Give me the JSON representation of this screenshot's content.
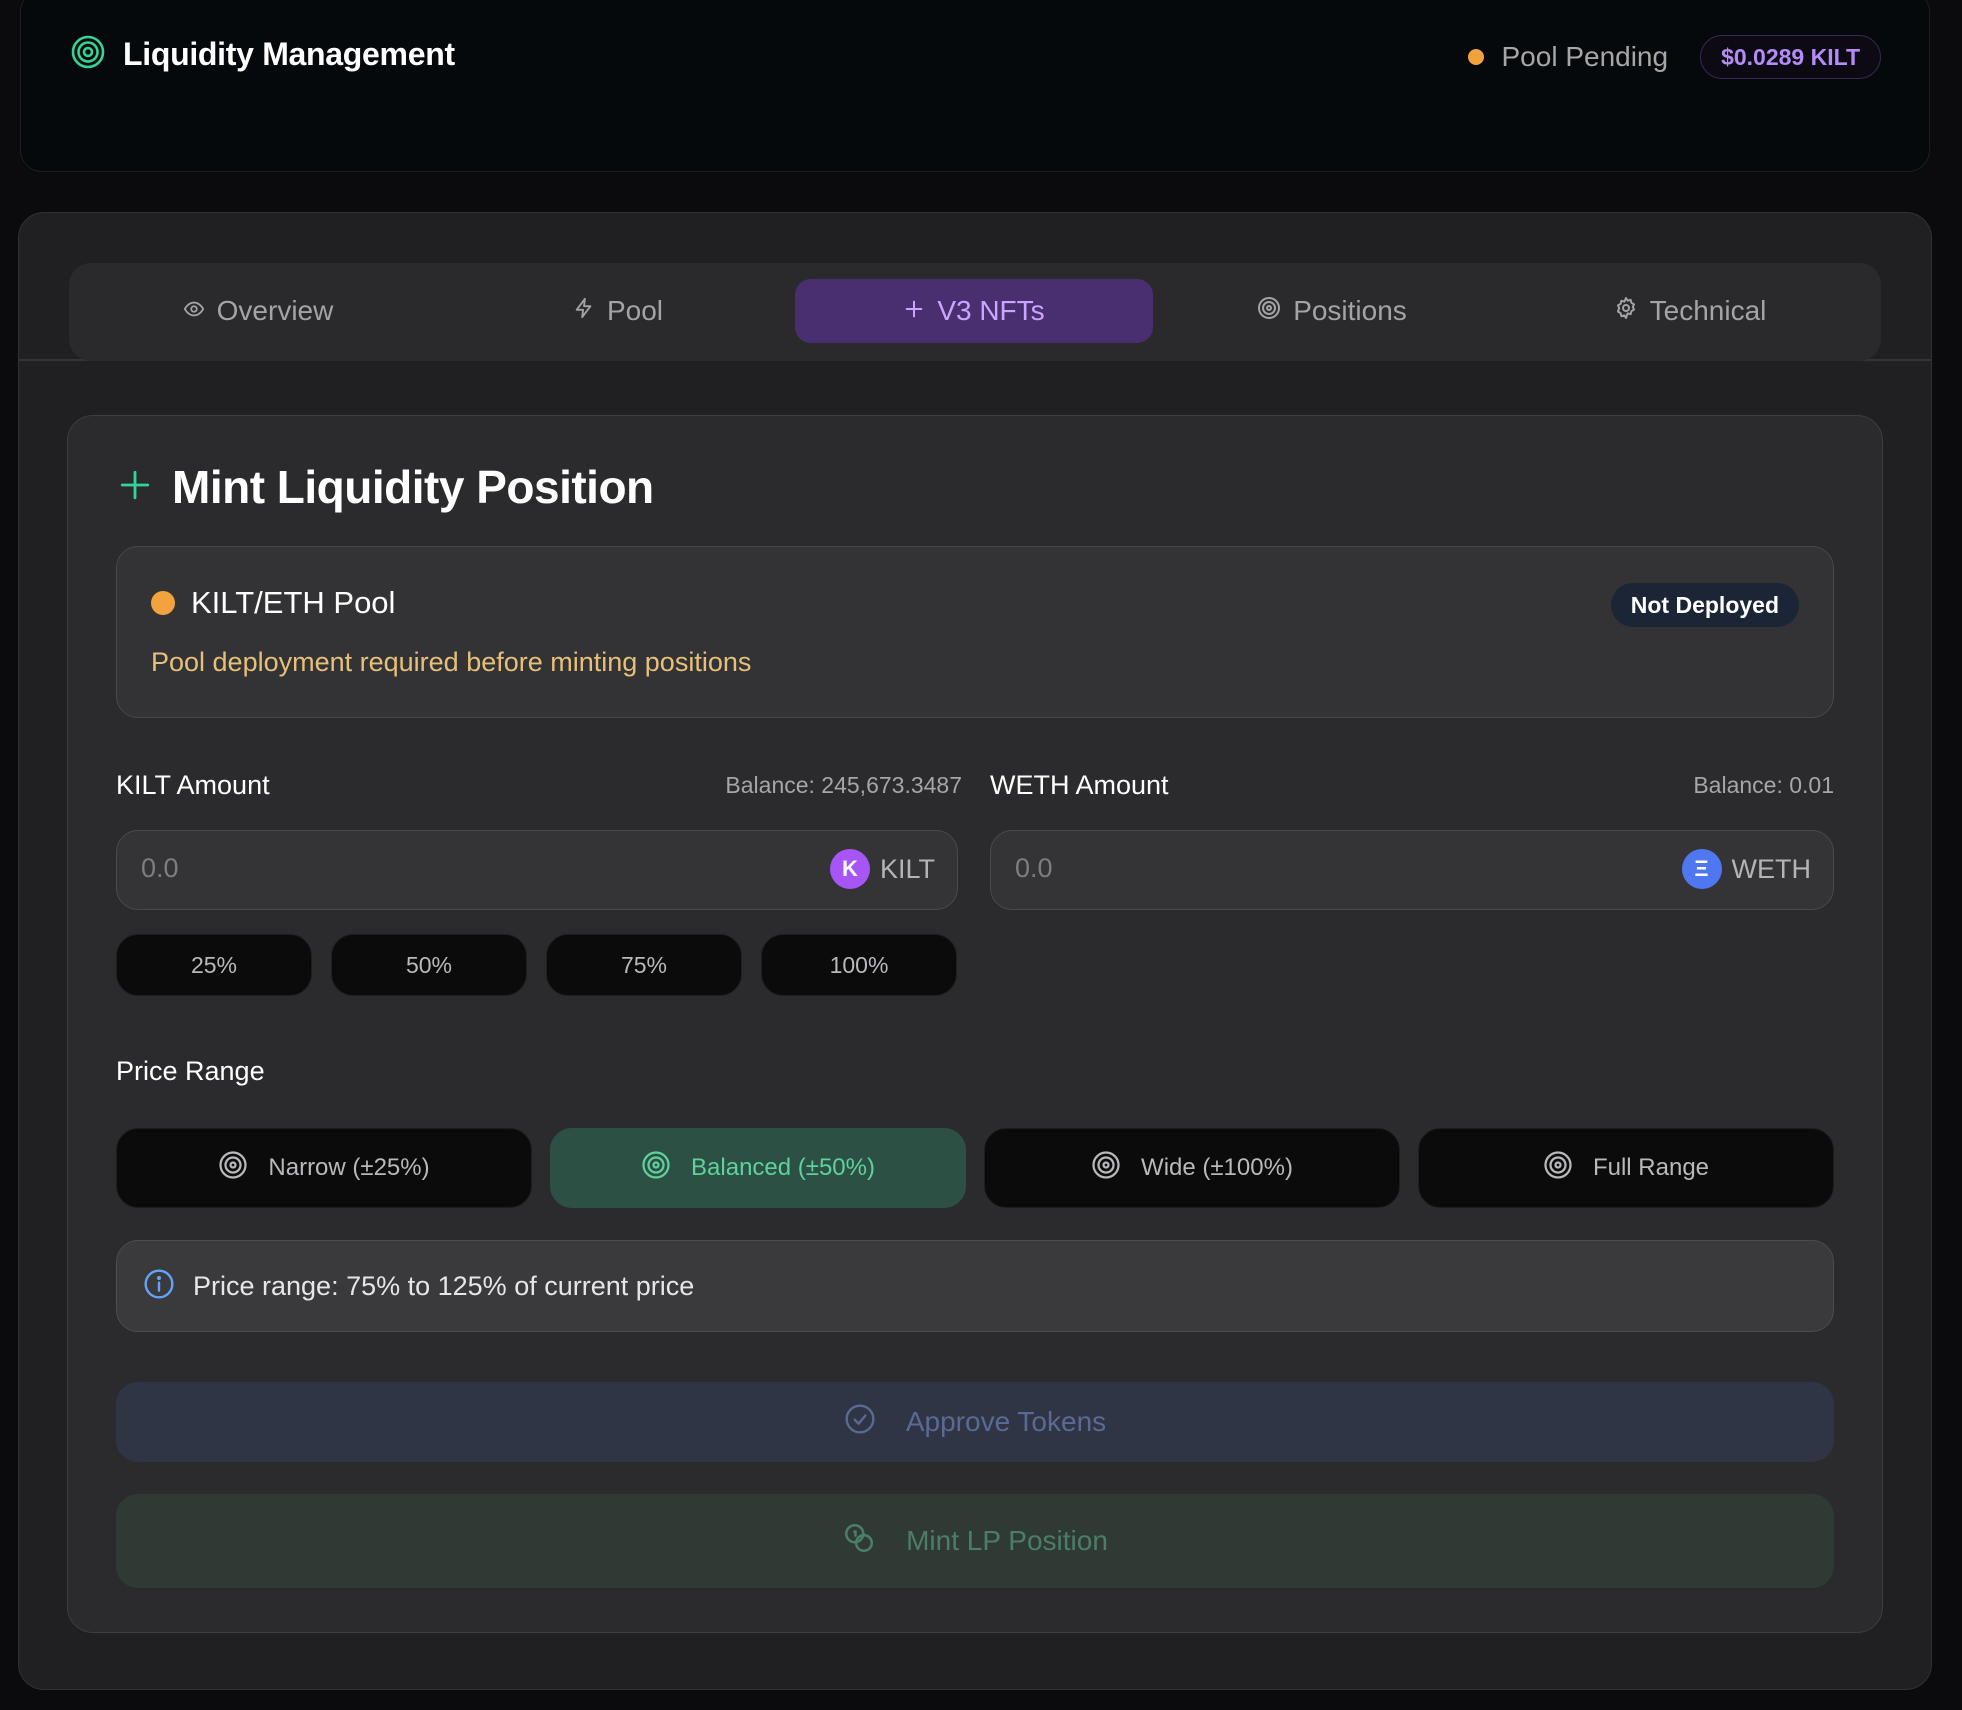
{
  "header": {
    "title": "Liquidity Management",
    "status_text": "Pool Pending",
    "price_badge": "$0.0289 KILT"
  },
  "tabs": [
    {
      "label": "Overview",
      "icon": "eye-icon"
    },
    {
      "label": "Pool",
      "icon": "lightning-icon"
    },
    {
      "label": "V3 NFTs",
      "icon": "plus-icon"
    },
    {
      "label": "Positions",
      "icon": "target-icon"
    },
    {
      "label": "Technical",
      "icon": "gear-icon"
    }
  ],
  "card": {
    "title": "Mint Liquidity Position",
    "pool": {
      "name": "KILT/ETH Pool",
      "message": "Pool deployment required before minting positions",
      "badge": "Not Deployed"
    },
    "kilt": {
      "label": "KILT Amount",
      "balance": "Balance: 245,673.3487",
      "placeholder": "0.0",
      "token_letter": "K",
      "token": "KILT"
    },
    "weth": {
      "label": "WETH Amount",
      "balance": "Balance: 0.01",
      "placeholder": "0.0",
      "token_letter": "Ξ",
      "token": "WETH"
    },
    "percent_buttons": [
      "25%",
      "50%",
      "75%",
      "100%"
    ],
    "price_range": {
      "label": "Price Range",
      "options": [
        "Narrow (±25%)",
        "Balanced (±50%)",
        "Wide (±100%)",
        "Full Range"
      ],
      "info": "Price range: 75% to 125% of current price"
    },
    "approve_label": "Approve Tokens",
    "mint_label": "Mint LP Position"
  },
  "colors": {
    "accent_purple": "#b38cf7",
    "accent_green": "#5fd19c",
    "warning_orange": "#f2a33d"
  }
}
